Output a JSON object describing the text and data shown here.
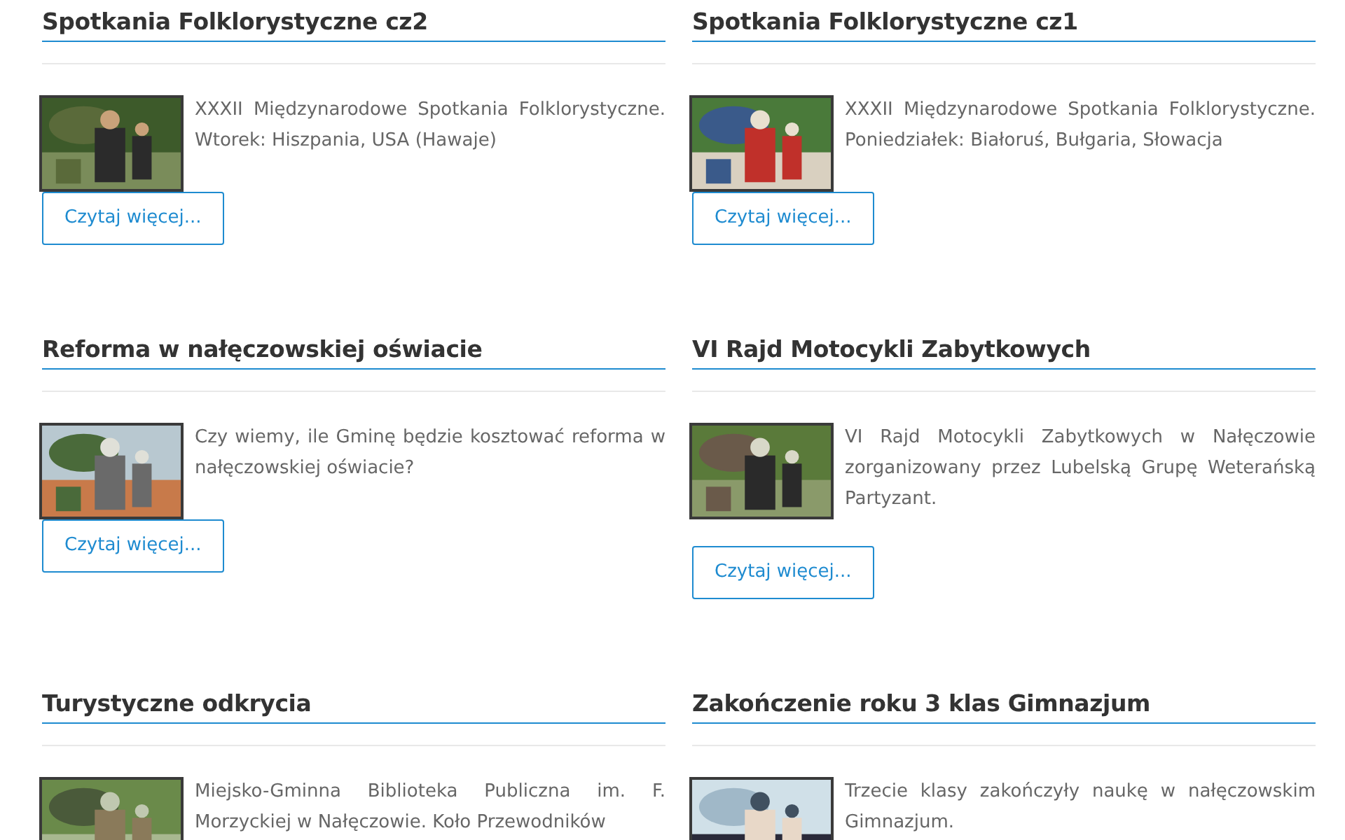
{
  "articles": [
    {
      "title": "Spotkania Folklorystyczne cz2",
      "text": "XXXII Międzynarodowe Spotkania Folklorystyczne. Wtorek: Hiszpania, USA (Hawaje)",
      "button": "Czytaj więcej..."
    },
    {
      "title": "Spotkania Folklorystyczne cz1",
      "text": "XXXII Międzynarodowe Spotkania Folklorystyczne. Poniedziałek: Białoruś, Bułgaria, Słowacja",
      "button": "Czytaj więcej..."
    },
    {
      "title": "Reforma w nałęczowskiej oświacie",
      "text": "Czy wiemy, ile Gminę będzie kosztować reforma w nałęczowskiej oświacie?",
      "button": "Czytaj więcej..."
    },
    {
      "title": "VI Rajd Motocykli Zabytkowych",
      "text": "VI Rajd Motocykli Zabytkowych w Nałęczowie zorganizowany przez Lubelską Grupę Weterańską Partyzant.",
      "button": "Czytaj więcej..."
    },
    {
      "title": "Turystyczne odkrycia",
      "text": "Miejsko-Gminna Biblioteka Publiczna im. F. Morzyckiej w Nałęczowie. Koło Przewodników"
    },
    {
      "title": "Zakończenie roku 3 klas Gimnazjum",
      "text": "Trzecie klasy zakończyły naukę w nałęczowskim Gimnazjum."
    }
  ]
}
